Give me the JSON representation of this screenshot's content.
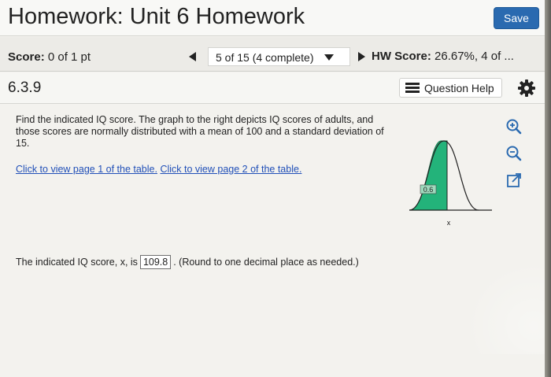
{
  "header": {
    "title": "Homework: Unit 6 Homework",
    "save_label": "Save"
  },
  "score_bar": {
    "score_label": "Score:",
    "score_value": " 0 of 1 pt",
    "progress_text": "5 of 15 (4 complete)",
    "hw_score_label": "HW Score:",
    "hw_score_value": " 26.67%, 4 of ..."
  },
  "question": {
    "number": "6.3.9",
    "help_label": "Question Help",
    "text": "Find the indicated IQ score. The graph to the right depicts IQ scores of adults, and those scores are normally distributed with a mean of 100 and a standard deviation of 15.",
    "link_page1": "Click to view page 1 of the table.",
    "link_page2": "Click to view page 2 of the table.",
    "graph": {
      "area_label": "0.6",
      "x_label": "x",
      "shaded_area_fraction": 0.6,
      "shade_color": "#23b37a"
    },
    "answer": {
      "prefix": "The indicated IQ score, x, is",
      "value": "109.8",
      "suffix": ". (Round to one decimal place as needed.)"
    }
  },
  "icons": {
    "zoom_in": "zoom-in-icon",
    "zoom_out": "zoom-out-icon",
    "popout": "popout-icon",
    "settings": "gear-icon",
    "list": "list-icon"
  },
  "colors": {
    "accent": "#2a6ab0",
    "link": "#2150b8"
  }
}
